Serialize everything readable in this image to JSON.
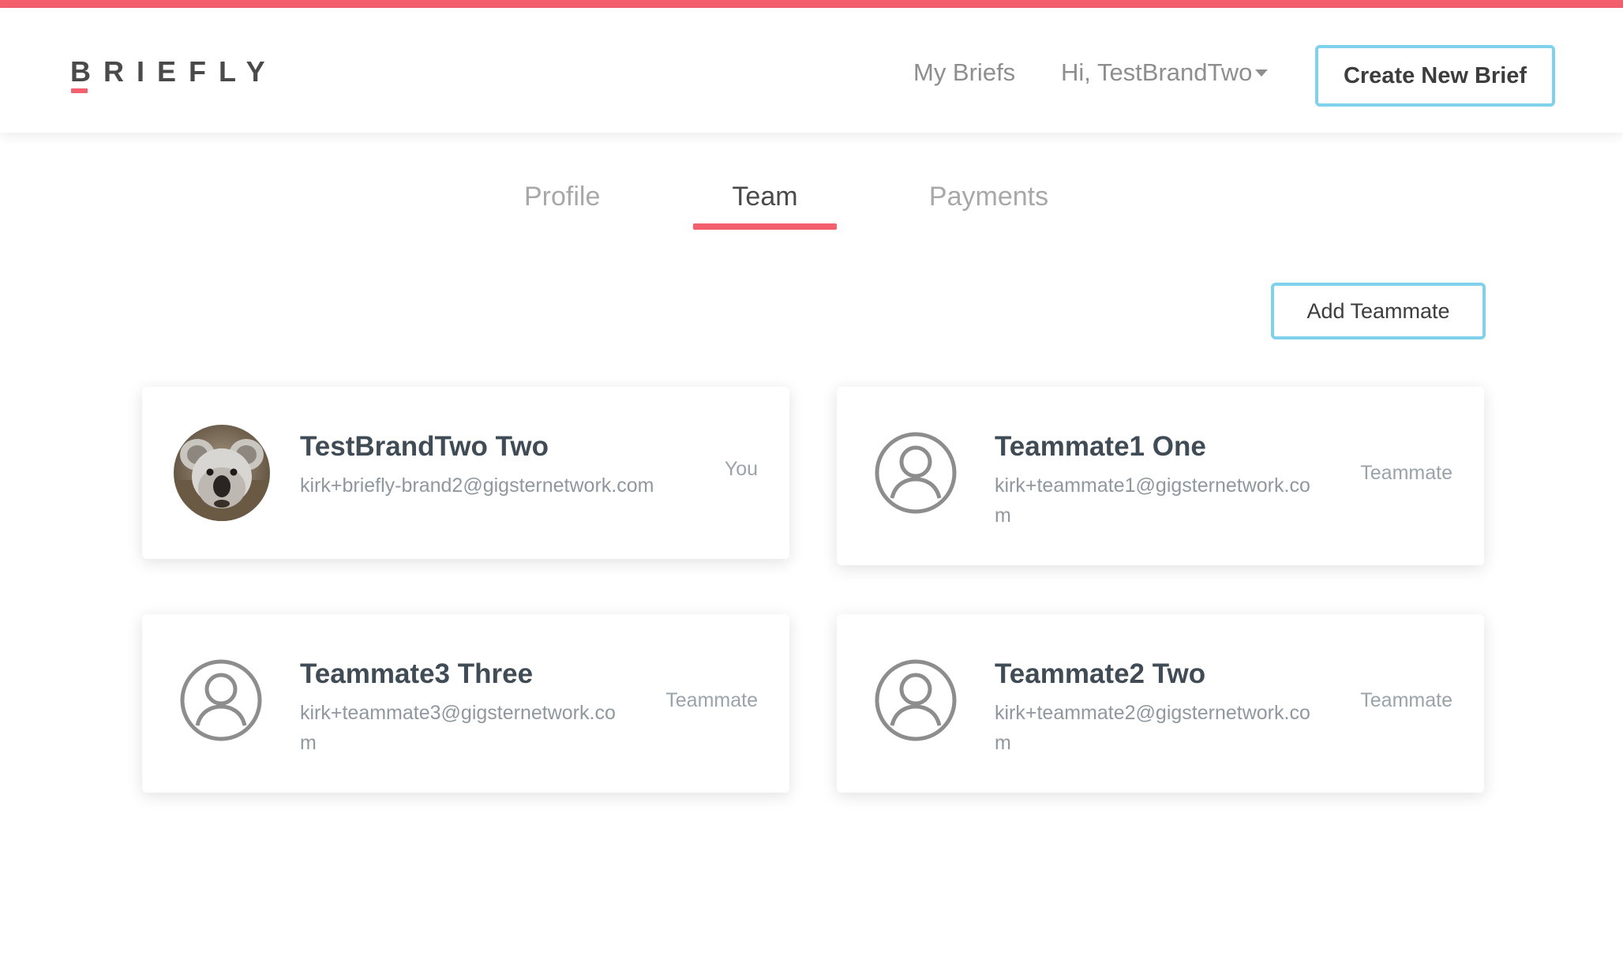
{
  "header": {
    "logo": "BRIEFLY",
    "nav": {
      "my_briefs": "My Briefs",
      "user_greeting": "Hi, TestBrandTwo"
    },
    "create_button": "Create New Brief"
  },
  "tabs": [
    {
      "label": "Profile",
      "active": false
    },
    {
      "label": "Team",
      "active": true
    },
    {
      "label": "Payments",
      "active": false
    }
  ],
  "add_teammate_button": "Add Teammate",
  "members": [
    {
      "name": "TestBrandTwo Two",
      "email": "kirk+briefly-brand2@gigsternetwork.com",
      "role": "You",
      "avatar": "koala-photo"
    },
    {
      "name": "Teammate1 One",
      "email": "kirk+teammate1@gigsternetwork.com",
      "role": "Teammate",
      "avatar": "user-icon"
    },
    {
      "name": "Teammate3 Three",
      "email": "kirk+teammate3@gigsternetwork.com",
      "role": "Teammate",
      "avatar": "user-icon"
    },
    {
      "name": "Teammate2 Two",
      "email": "kirk+teammate2@gigsternetwork.com",
      "role": "Teammate",
      "avatar": "user-icon"
    }
  ],
  "colors": {
    "accent": "#f4606e",
    "button_border": "#7fd1ec",
    "text_dark": "#3f4b55",
    "text_muted": "#8f989f"
  }
}
